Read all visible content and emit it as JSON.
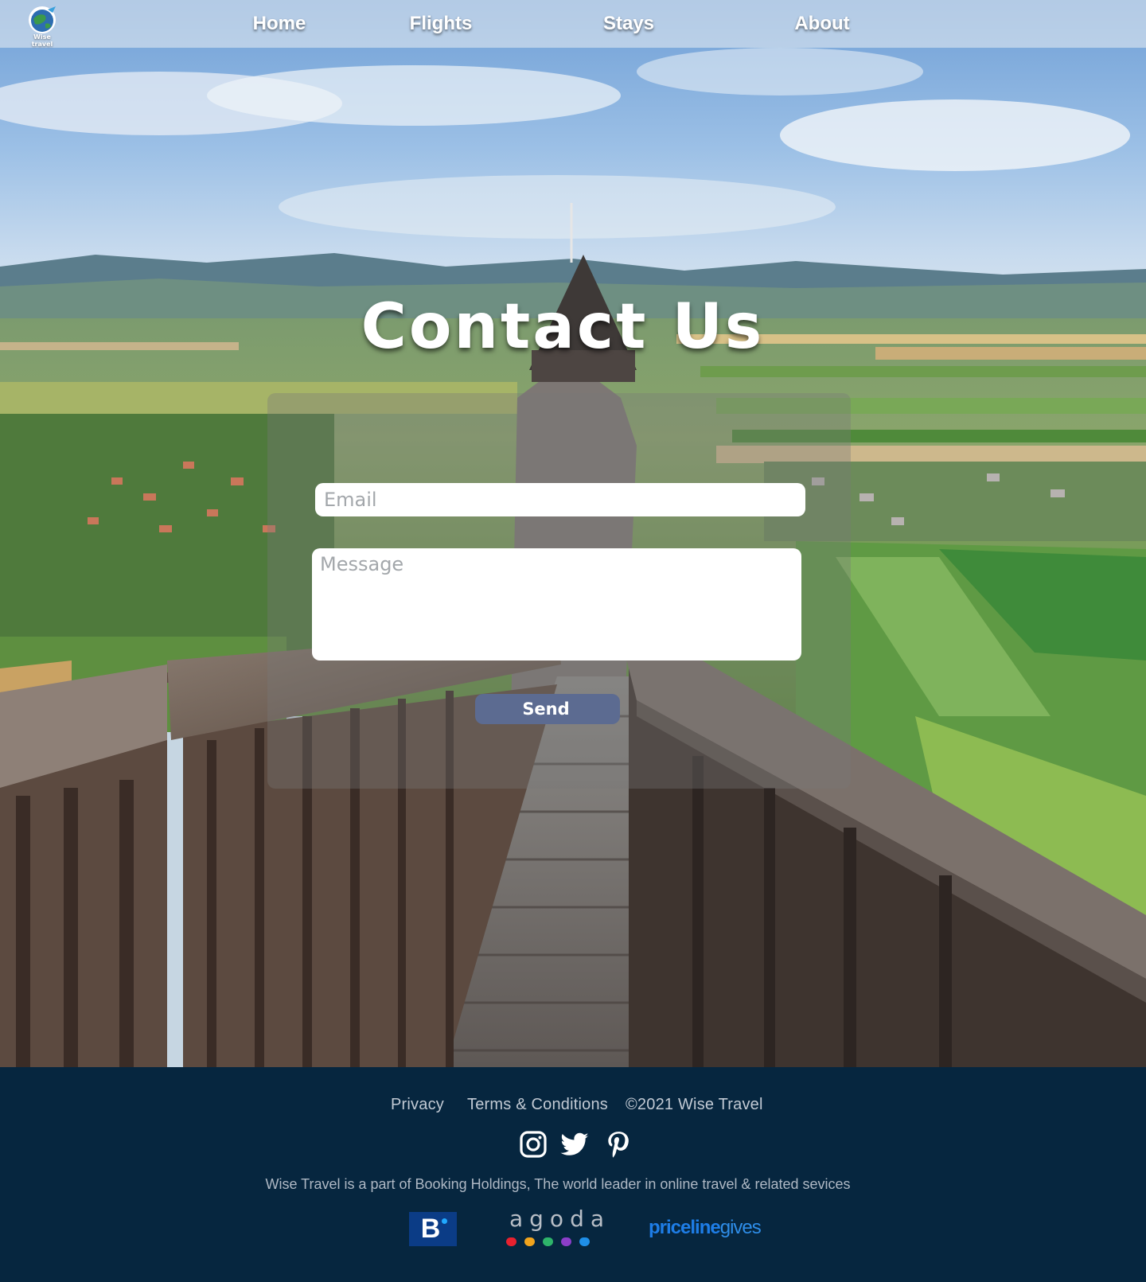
{
  "brand": {
    "name": "Wise travel",
    "logo_icon": "globe-icon"
  },
  "nav": {
    "items": [
      {
        "label": "Home"
      },
      {
        "label": "Flights"
      },
      {
        "label": "Stays"
      },
      {
        "label": "About"
      }
    ]
  },
  "contact": {
    "title": "Contact Us",
    "email_placeholder": "Email",
    "message_placeholder": "Message",
    "send_label": "Send"
  },
  "footer": {
    "links": {
      "privacy": "Privacy",
      "terms": "Terms & Conditions"
    },
    "copyright": "©2021 Wise Travel",
    "social": [
      {
        "icon": "instagram-icon"
      },
      {
        "icon": "twitter-icon"
      },
      {
        "icon": "pinterest-icon"
      }
    ],
    "tagline": "Wise Travel is a part of Booking Holdings, The world leader in online travel & related sevices",
    "partners": {
      "booking": "B",
      "agoda": "agoda",
      "priceline_a": "priceline",
      "priceline_b": "gives"
    }
  },
  "colors": {
    "footer_bg": "#06263f",
    "send_button": "#5c6b91",
    "booking_blue": "#0b3c86",
    "priceline_blue": "#1e7de6"
  }
}
